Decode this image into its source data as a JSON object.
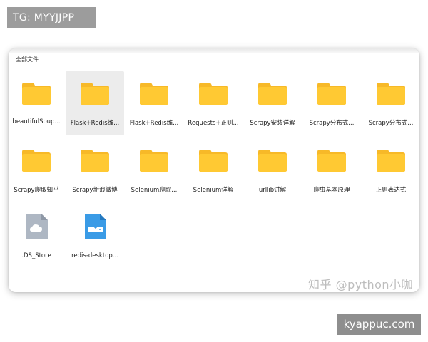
{
  "overlay": {
    "tg_label": "TG: MYYJJPP",
    "watermark": "知乎 @python小咖",
    "site": "kyappuc.com"
  },
  "window": {
    "section_title": "全部文件",
    "items": [
      {
        "label": "beautifulSoup...",
        "type": "folder"
      },
      {
        "label": "Flask+Redis维...",
        "type": "folder",
        "selected": true
      },
      {
        "label": "Flask+Redis维...",
        "type": "folder"
      },
      {
        "label": "Requests+正则...",
        "type": "folder"
      },
      {
        "label": "Scrapy安装详解",
        "type": "folder"
      },
      {
        "label": "Scrapy分布式...",
        "type": "folder"
      },
      {
        "label": "Scrapy分布式...",
        "type": "folder"
      },
      {
        "label": "Scrapy爬取知乎",
        "type": "folder"
      },
      {
        "label": "Scrapy新浪微博",
        "type": "folder"
      },
      {
        "label": "Selenium爬取...",
        "type": "folder"
      },
      {
        "label": "Selenium详解",
        "type": "folder"
      },
      {
        "label": "urllib讲解",
        "type": "folder"
      },
      {
        "label": "爬虫基本原理",
        "type": "folder"
      },
      {
        "label": "正则表达式",
        "type": "folder"
      },
      {
        "label": ".DS_Store",
        "type": "file-cloud"
      },
      {
        "label": "redis-desktop...",
        "type": "file-install"
      }
    ]
  },
  "colors": {
    "folder": "#FFC933",
    "folder_tab": "#F7B928",
    "file_gray": "#AEB7C3",
    "file_blue": "#3A9BE6"
  }
}
